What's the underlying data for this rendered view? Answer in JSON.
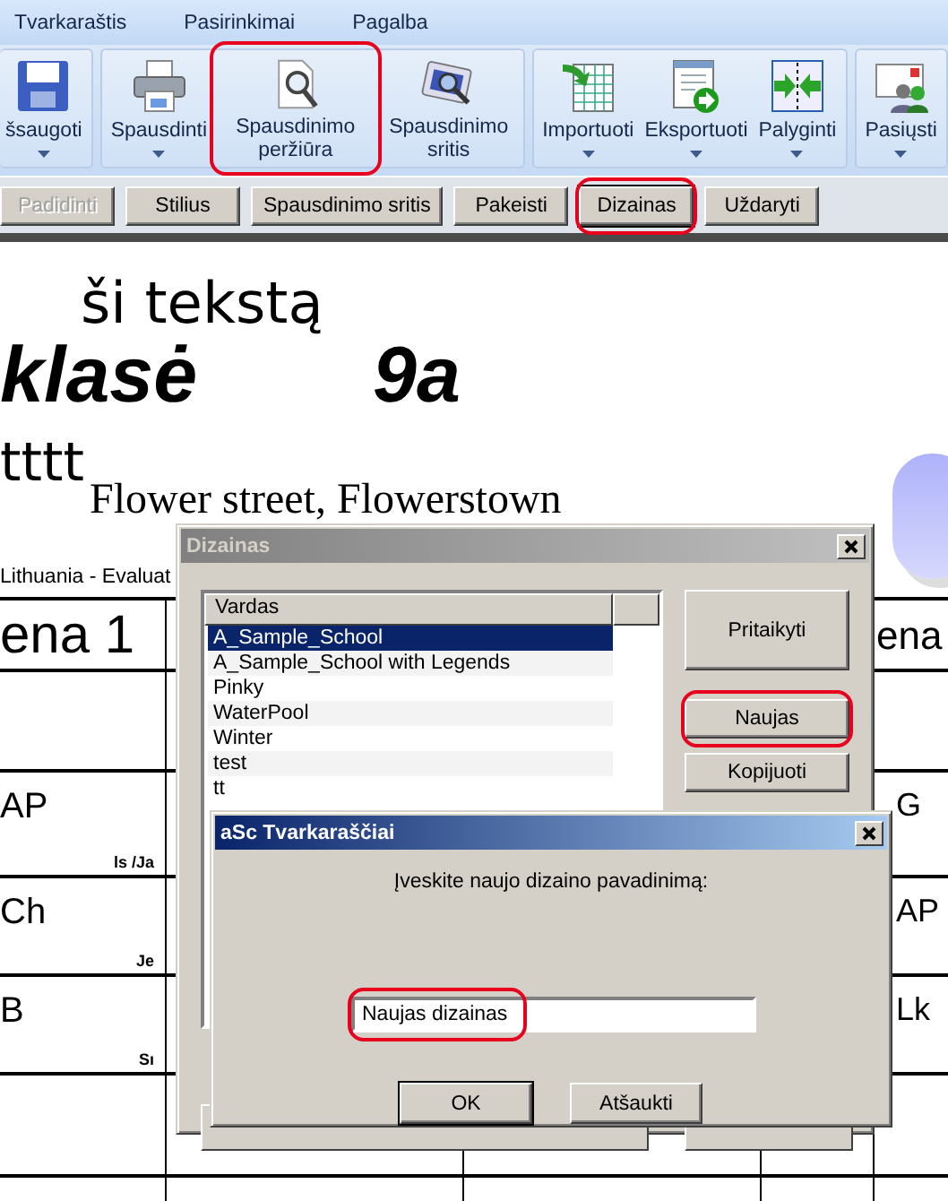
{
  "menu": [
    {
      "label": "Tvarkaraštis"
    },
    {
      "label": "Pasirinkimai"
    },
    {
      "label": "Pagalba"
    }
  ],
  "ribbon": {
    "groups": [
      {
        "buttons": [
          {
            "label": "šsaugoti",
            "kind": "save",
            "dropdown": true,
            "highlighted": false
          }
        ]
      },
      {
        "buttons": [
          {
            "label": "Spausdinti",
            "kind": "printer",
            "dropdown": true,
            "highlighted": false
          },
          {
            "label": "Spausdinimo peržiūra",
            "kind": "preview",
            "dropdown": false,
            "highlighted": true
          },
          {
            "label": "Spausdinimo sritis",
            "kind": "area",
            "dropdown": false,
            "highlighted": false
          }
        ]
      },
      {
        "buttons": [
          {
            "label": "Importuoti",
            "kind": "import",
            "dropdown": true,
            "highlighted": false
          },
          {
            "label": "Eksportuoti",
            "kind": "export",
            "dropdown": true,
            "highlighted": false
          },
          {
            "label": "Palyginti",
            "kind": "compare",
            "dropdown": true,
            "highlighted": false
          }
        ]
      },
      {
        "buttons": [
          {
            "label": "Pasiųsti",
            "kind": "send",
            "dropdown": true,
            "highlighted": false
          }
        ]
      }
    ]
  },
  "toolbar": {
    "buttons": [
      {
        "label": "Padidinti",
        "disabled": true,
        "focused": false,
        "highlighted": false
      },
      {
        "label": "Stilius",
        "disabled": false,
        "focused": false,
        "highlighted": false
      },
      {
        "label": "Spausdinimo sritis",
        "disabled": false,
        "focused": false,
        "highlighted": false
      },
      {
        "label": "Pakeisti",
        "disabled": false,
        "focused": false,
        "highlighted": false
      },
      {
        "label": "Dizainas",
        "disabled": false,
        "focused": true,
        "highlighted": true
      },
      {
        "label": "Uždaryti",
        "disabled": false,
        "focused": false,
        "highlighted": false
      }
    ]
  },
  "document": {
    "overlay_text": "ši tekstą",
    "class_label": "klasė",
    "class_name": "9a",
    "subtitle": "tttt",
    "address": "Flower street, Flowerstown",
    "note": "Lithuania - Evaluat",
    "table": {
      "header": [
        "ena 1",
        "ena"
      ],
      "rows": [
        {},
        {
          "subject": "AP",
          "teacher": "ls /Ja",
          "last": "G"
        },
        {
          "subject": "Ch",
          "teacher": "Je",
          "last": "AP"
        },
        {
          "subject": "B",
          "teacher": "Sı",
          "last": "Lk"
        },
        {},
        {}
      ]
    }
  },
  "design_dialog": {
    "title": "Dizainas",
    "active": false,
    "list": {
      "column": "Vardas",
      "items": [
        {
          "label": "A_Sample_School",
          "selected": true
        },
        {
          "label": "A_Sample_School with Legends",
          "selected": false
        },
        {
          "label": "Pinky",
          "selected": false
        },
        {
          "label": "WaterPool",
          "selected": false
        },
        {
          "label": "Winter",
          "selected": false
        },
        {
          "label": "test",
          "selected": false
        },
        {
          "label": "tt",
          "selected": false
        }
      ]
    },
    "buttons": [
      {
        "label": "Pritaikyti",
        "highlighted": false
      },
      {
        "label": "Naujas",
        "highlighted": true
      },
      {
        "label": "Kopijuoti",
        "highlighted": false
      }
    ]
  },
  "name_dialog": {
    "title": "aSc Tvarkaraščiai",
    "active": true,
    "prompt": "Įveskite naujo dizaino pavadinimą:",
    "input": {
      "value": "Naujas dizainas",
      "highlighted": true
    },
    "buttons": [
      {
        "label": "OK",
        "focused": true
      },
      {
        "label": "Atšaukti",
        "focused": false
      }
    ]
  }
}
